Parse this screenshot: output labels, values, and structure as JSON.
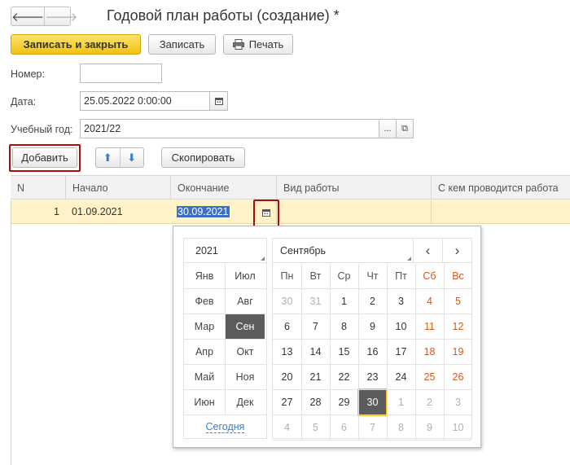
{
  "window": {
    "title": "Годовой план работы (создание) *"
  },
  "nav": {
    "back_icon": "arrow-left-icon",
    "forward_icon": "arrow-right-icon",
    "back": "🡐",
    "forward": "🡒"
  },
  "toolbar": {
    "save_close": "Записать и закрыть",
    "save": "Записать",
    "print": "Печать"
  },
  "form": {
    "number_label": "Номер:",
    "number_value": "",
    "date_label": "Дата:",
    "date_value": "25.05.2022  0:00:00",
    "year_label": "Учебный год:",
    "year_value": "2021/22",
    "ellipsis": "...",
    "open_icon": "⧉"
  },
  "table_toolbar": {
    "add": "Добавить",
    "up": "⬆",
    "down": "⬇",
    "copy": "Скопировать"
  },
  "table": {
    "columns": [
      "N",
      "Начало",
      "Окончание",
      "Вид работы",
      "С кем проводится работа"
    ],
    "rows": [
      {
        "n": "1",
        "start": "01.09.2021",
        "end": "30.09.2021",
        "type": "",
        "with": ""
      }
    ]
  },
  "calendar": {
    "year": "2021",
    "month": "Сентябрь",
    "prev": "‹",
    "next": "›",
    "months_col1": [
      "Янв",
      "Фев",
      "Мар",
      "Апр",
      "Май",
      "Июн"
    ],
    "months_col2": [
      "Июл",
      "Авг",
      "Сен",
      "Окт",
      "Ноя",
      "Дек"
    ],
    "selected_month": "Сен",
    "today": "Сегодня",
    "weekdays": [
      "Пн",
      "Вт",
      "Ср",
      "Чт",
      "Пт",
      "Сб",
      "Вс"
    ],
    "weeks": [
      [
        "30",
        "31",
        "1",
        "2",
        "3",
        "4",
        "5"
      ],
      [
        "6",
        "7",
        "8",
        "9",
        "10",
        "11",
        "12"
      ],
      [
        "13",
        "14",
        "15",
        "16",
        "17",
        "18",
        "19"
      ],
      [
        "20",
        "21",
        "22",
        "23",
        "24",
        "25",
        "26"
      ],
      [
        "27",
        "28",
        "29",
        "30",
        "1",
        "2",
        "3"
      ],
      [
        "4",
        "5",
        "6",
        "7",
        "8",
        "9",
        "10"
      ]
    ],
    "selected_day": "30",
    "colors": {
      "weekend": "#d7581c",
      "selected_bg": "#5c5c5c",
      "selected_outline": "#f3c01a",
      "other_month": "#b0b0b0"
    }
  }
}
